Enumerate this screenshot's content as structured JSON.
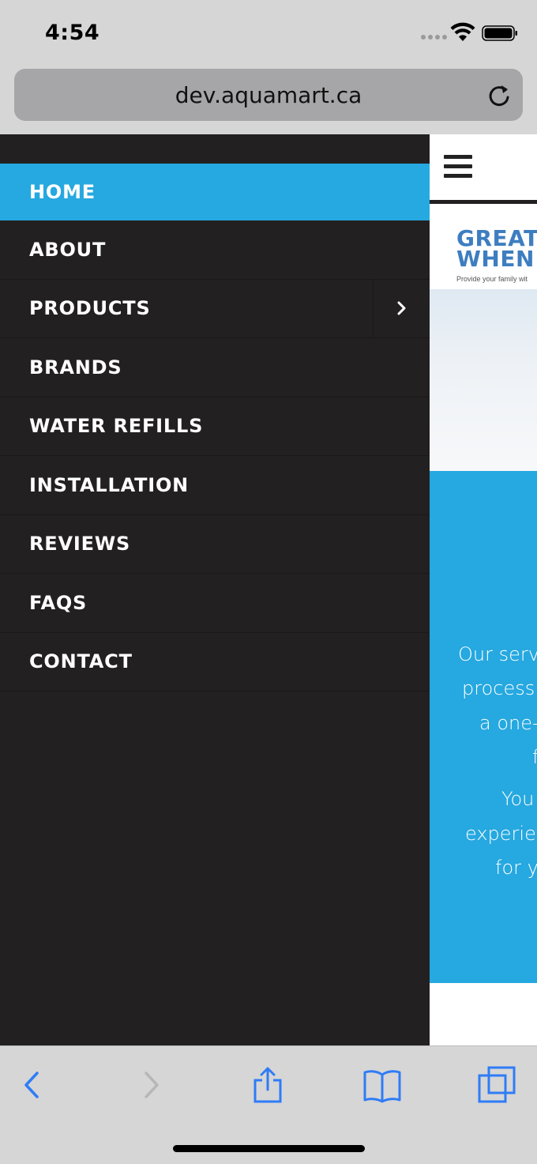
{
  "status_bar": {
    "time": "4:54"
  },
  "browser": {
    "url": "dev.aquamart.ca"
  },
  "menu": {
    "items": [
      {
        "label": "HOME",
        "active": true
      },
      {
        "label": "ABOUT"
      },
      {
        "label": "PRODUCTS",
        "has_submenu": true
      },
      {
        "label": "BRANDS"
      },
      {
        "label": "WATER REFILLS"
      },
      {
        "label": "INSTALLATION"
      },
      {
        "label": "REVIEWS"
      },
      {
        "label": "FAQS"
      },
      {
        "label": "CONTACT"
      }
    ]
  },
  "page": {
    "banner_line1": "GREAT",
    "banner_line2": "WHEN",
    "banner_sub": "Provide your family wit",
    "blue_lines": [
      "Our serv",
      "process!",
      "a one-",
      "f",
      "You",
      "experien",
      "for y"
    ]
  },
  "colors": {
    "accent": "#26a8e0",
    "menu_bg": "#232021",
    "ios_blue": "#2f7cf6"
  }
}
